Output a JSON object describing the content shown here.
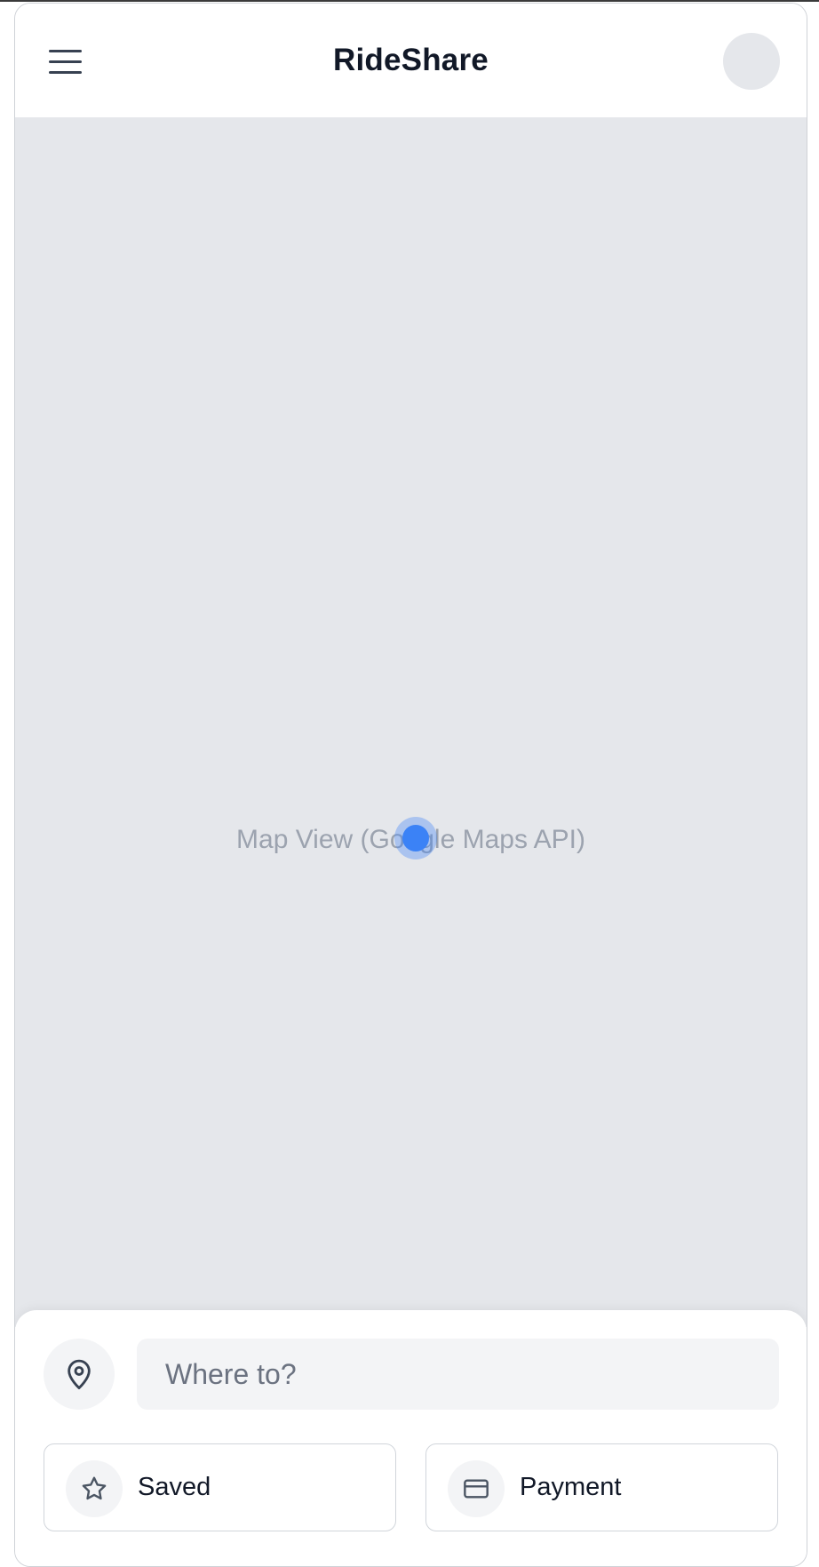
{
  "header": {
    "title": "RideShare",
    "menu_icon": "hamburger-menu-icon",
    "avatar": "user-avatar"
  },
  "map": {
    "label": "Map View (Google Maps API)",
    "location_marker_color": "#3b82f6"
  },
  "search": {
    "placeholder": "Where to?",
    "value": "",
    "icon": "map-pin-icon"
  },
  "actions": [
    {
      "label": "Saved",
      "icon": "star-icon"
    },
    {
      "label": "Payment",
      "icon": "credit-card-icon"
    }
  ],
  "colors": {
    "map_bg": "#e5e7eb",
    "accent": "#3b82f6",
    "text_primary": "#111827",
    "text_muted": "#9ca3af"
  }
}
